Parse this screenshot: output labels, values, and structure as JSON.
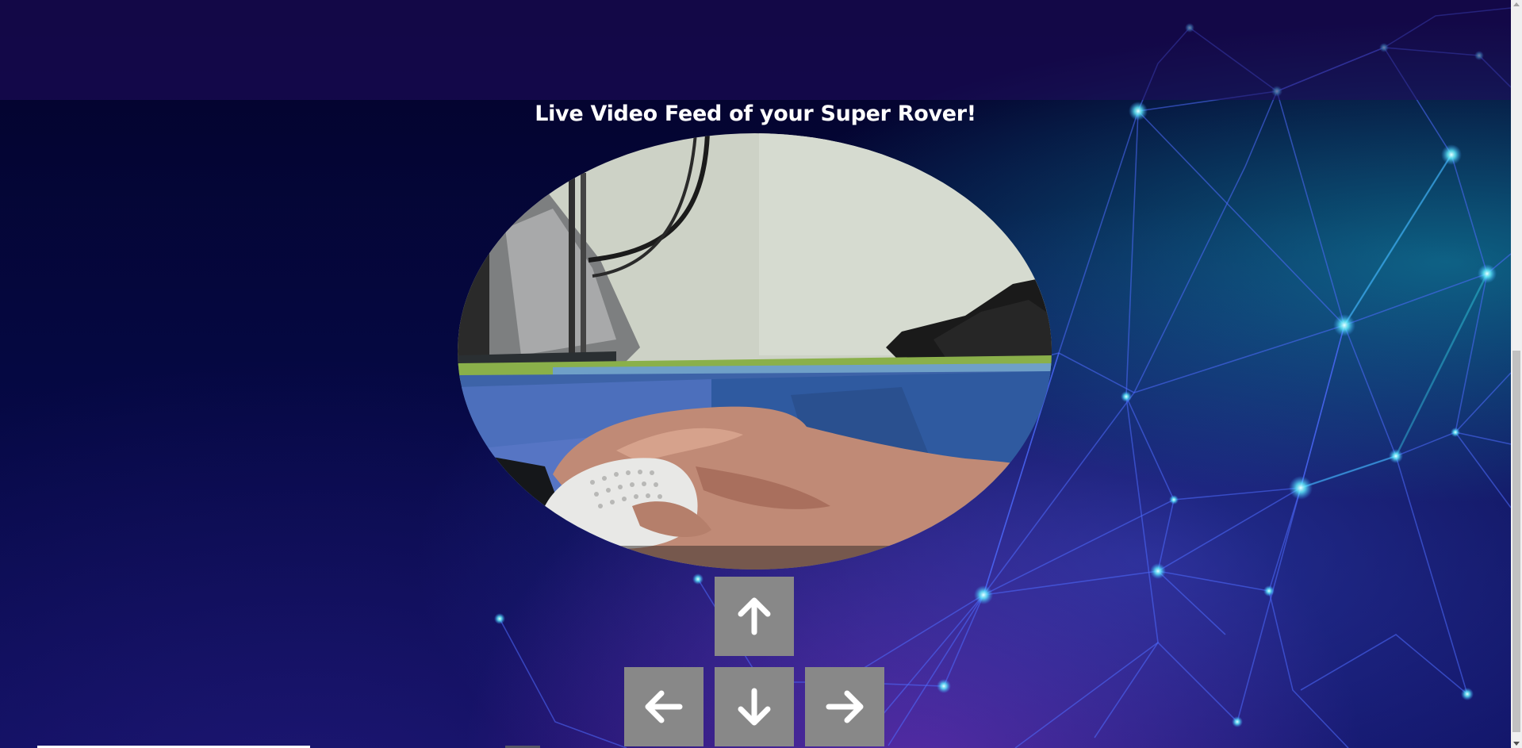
{
  "header": {
    "title": "Live Video Feed of your Super Rover!"
  },
  "video": {
    "shape": "ellipse",
    "content": "live-camera-feed"
  },
  "controls": {
    "up": {
      "icon": "arrow-up-icon"
    },
    "left": {
      "icon": "arrow-left-icon"
    },
    "down": {
      "icon": "arrow-down-icon"
    },
    "right": {
      "icon": "arrow-right-icon"
    }
  },
  "colors": {
    "background": "#05052e",
    "top_bar": "#1a0c5c",
    "control_button": "#888888",
    "arrow": "#ffffff",
    "title_text": "#ffffff",
    "network_lines": "#4a6bff",
    "network_glow": "#2de0f0"
  }
}
